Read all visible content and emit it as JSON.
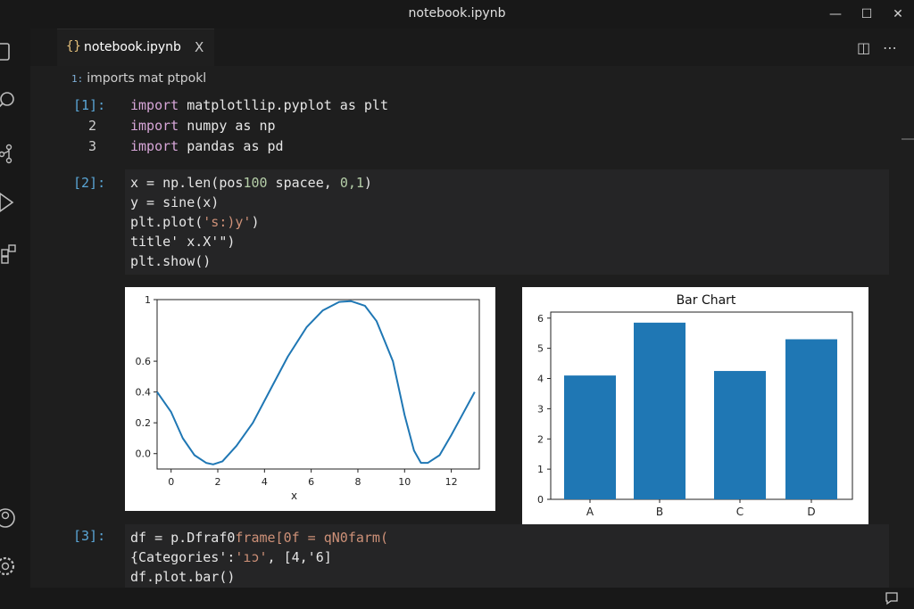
{
  "window": {
    "title": "notebook.ipynb"
  },
  "tab": {
    "brace": "{}",
    "label": "notebook.ipynb",
    "close": "X"
  },
  "breadcrumb": {
    "icon": "1:",
    "text": "imports mat ptpokl"
  },
  "cells": [
    {
      "exec": "[1]:",
      "line_numbers": [
        "2",
        "3"
      ],
      "lines": [
        {
          "kw": "import",
          "rest": " matplotllip.pyplot as plt"
        },
        {
          "kw": "import",
          "rest": " numpy as np"
        },
        {
          "kw": "import",
          "rest": " pandas as pd"
        }
      ]
    },
    {
      "exec": "[2]:",
      "lines": [
        {
          "pre": "x = np.len(pos",
          "num1": "100",
          "mid": " spacee, ",
          "num2": "0,1",
          "post": ")"
        },
        {
          "text": "y = sine(x)"
        },
        {
          "pre": "plt.plot(",
          "str": "'s:)y'",
          "post": ")"
        },
        {
          "text": "title' x.X'\")"
        },
        {
          "text": "plt.show()"
        }
      ]
    },
    {
      "exec": "[3]:",
      "lines": [
        {
          "pre": "df = p.Dfraf0",
          "str": "frame[0f = qN0farm(",
          "post": ""
        },
        {
          "pre": "{Categories':",
          "str": "'ıɔ'",
          "post": ", [4,'6]"
        },
        {
          "text": "df.plot.bar()"
        }
      ]
    }
  ],
  "chart_data": [
    {
      "type": "line",
      "title": "",
      "xlabel": "x",
      "ylabel": "",
      "x_ticks": [
        "0",
        "2",
        "4",
        "6",
        "8",
        "10",
        "12"
      ],
      "y_ticks": [
        "0.0",
        "0.2",
        "0.4",
        "0.6",
        "1"
      ],
      "xlim": [
        -0.6,
        13.2
      ],
      "ylim": [
        -0.1,
        1.0
      ],
      "series": [
        {
          "x": [
            -0.6,
            0.0,
            0.5,
            1.0,
            1.5,
            1.8,
            2.2,
            2.8,
            3.5,
            4.3,
            5.0,
            5.8,
            6.5,
            7.2,
            7.7,
            8.0,
            8.3,
            8.8,
            9.5,
            10.0,
            10.4,
            10.7,
            11.0,
            11.5,
            12.0,
            12.5,
            13.0
          ],
          "y": [
            0.4,
            0.27,
            0.1,
            -0.01,
            -0.06,
            -0.07,
            -0.05,
            0.05,
            0.2,
            0.43,
            0.63,
            0.82,
            0.93,
            0.985,
            0.99,
            0.975,
            0.96,
            0.86,
            0.6,
            0.25,
            0.02,
            -0.06,
            -0.06,
            -0.01,
            0.12,
            0.26,
            0.4
          ]
        }
      ]
    },
    {
      "type": "bar",
      "title": "Bar Chart",
      "categories": [
        "A",
        "B",
        "C",
        "D"
      ],
      "values": [
        4.1,
        5.85,
        4.25,
        5.3
      ],
      "y_ticks": [
        "0",
        "1",
        "2",
        "3",
        "4",
        "5",
        "6"
      ],
      "ylim": [
        0,
        6.2
      ]
    }
  ],
  "colors": {
    "accent": "#1f77b4",
    "exec_count": "#5aa6d6",
    "keyword": "#d7a6d8"
  }
}
